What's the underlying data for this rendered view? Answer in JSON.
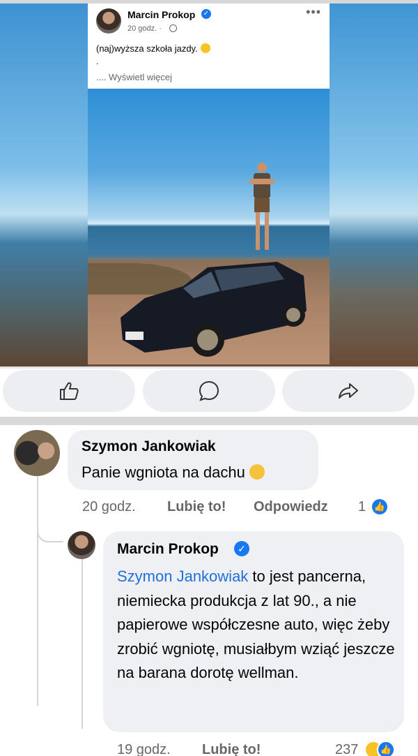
{
  "post": {
    "author": "Marcin Prokop",
    "time": "20 godz. ·",
    "text": "(naj)wyższa szkoła jazdy.",
    "dot": ".",
    "see_more": ".... Wyświetl więcej"
  },
  "comments": [
    {
      "author": "Szymon Jankowiak",
      "text": "Panie wgniota na dachu",
      "time": "20 godz.",
      "like_label": "Lubię to!",
      "reply_label": "Odpowiedz",
      "reaction_count": "1"
    },
    {
      "author": "Marcin Prokop",
      "mention": "Szymon Jankowiak",
      "text": " to jest pancerna, niemiecka produkcja z lat 90., a nie papierowe współczesne auto, więc żeby zrobić wgniotę, musiałbym wziąć jeszcze na barana dorotę wellman.",
      "time": "19 godz.",
      "like_label": "Lubię to!",
      "reaction_count": "237"
    }
  ],
  "icons": {
    "like": "thumbs-up-icon",
    "comment": "comment-bubble-icon",
    "share": "share-arrow-icon",
    "verified": "verified-badge-icon",
    "more": "more-options-icon",
    "privacy": "globe-icon"
  },
  "colors": {
    "verified": "#1877f2",
    "mention": "#216fdb",
    "meta_text": "#65676b",
    "bubble": "#eef0f3"
  }
}
